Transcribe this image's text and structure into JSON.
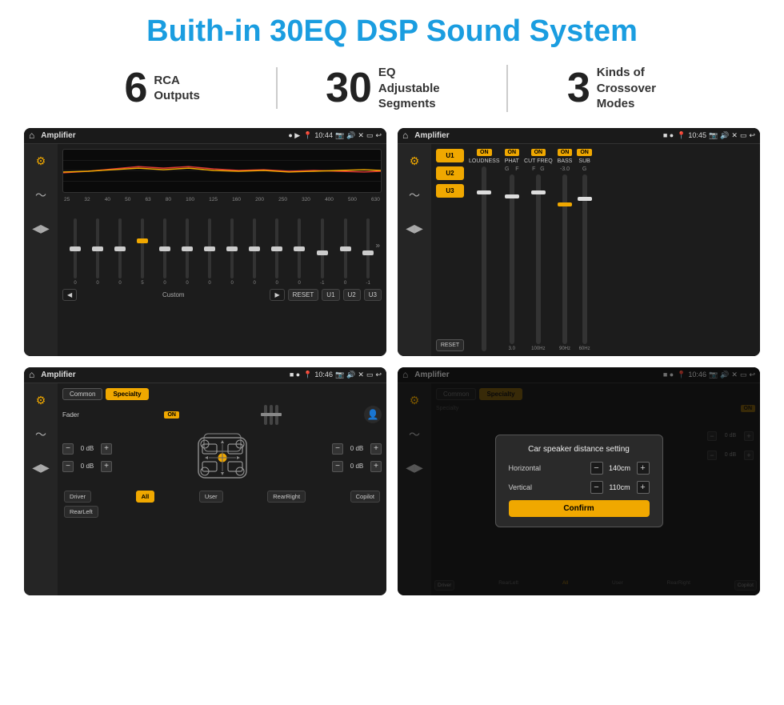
{
  "header": {
    "title": "Buith-in 30EQ DSP Sound System"
  },
  "stats": [
    {
      "number": "6",
      "label": "RCA\nOutputs"
    },
    {
      "number": "30",
      "label": "EQ Adjustable\nSegments"
    },
    {
      "number": "3",
      "label": "Kinds of\nCrossover Modes"
    }
  ],
  "screens": {
    "eq_screen": {
      "status_bar": {
        "app": "Amplifier",
        "time": "10:44"
      },
      "freq_labels": [
        "25",
        "32",
        "40",
        "50",
        "63",
        "80",
        "100",
        "125",
        "160",
        "200",
        "250",
        "320",
        "400",
        "500",
        "630"
      ],
      "slider_values": [
        "0",
        "0",
        "0",
        "5",
        "0",
        "0",
        "0",
        "0",
        "0",
        "0",
        "0",
        "-1",
        "0",
        "-1"
      ],
      "bottom_buttons": [
        "Custom",
        "RESET",
        "U1",
        "U2",
        "U3"
      ]
    },
    "mixer_screen": {
      "status_bar": {
        "app": "Amplifier",
        "time": "10:45"
      },
      "presets": [
        "U1",
        "U2",
        "U3"
      ],
      "channels": [
        "LOUDNESS",
        "PHAT",
        "CUT FREQ",
        "BASS",
        "SUB"
      ],
      "reset_label": "RESET"
    },
    "fader_screen": {
      "status_bar": {
        "app": "Amplifier",
        "time": "10:46"
      },
      "tabs": [
        "Common",
        "Specialty"
      ],
      "fader_label": "Fader",
      "db_values": [
        "0 dB",
        "0 dB",
        "0 dB",
        "0 dB"
      ],
      "bottom_labels": [
        "Driver",
        "All",
        "User",
        "RearRight",
        "Copilot",
        "RearLeft"
      ]
    },
    "dialog_screen": {
      "status_bar": {
        "app": "Amplifier",
        "time": "10:46"
      },
      "tabs": [
        "Common",
        "Specialty"
      ],
      "dialog": {
        "title": "Car speaker distance setting",
        "horizontal_label": "Horizontal",
        "horizontal_value": "140cm",
        "vertical_label": "Vertical",
        "vertical_value": "110cm",
        "confirm_label": "Confirm"
      },
      "db_values": [
        "0 dB",
        "0 dB"
      ],
      "bottom_labels": [
        "Driver",
        "RearLeft",
        "All",
        "User",
        "RearRight",
        "Copilot"
      ]
    }
  }
}
